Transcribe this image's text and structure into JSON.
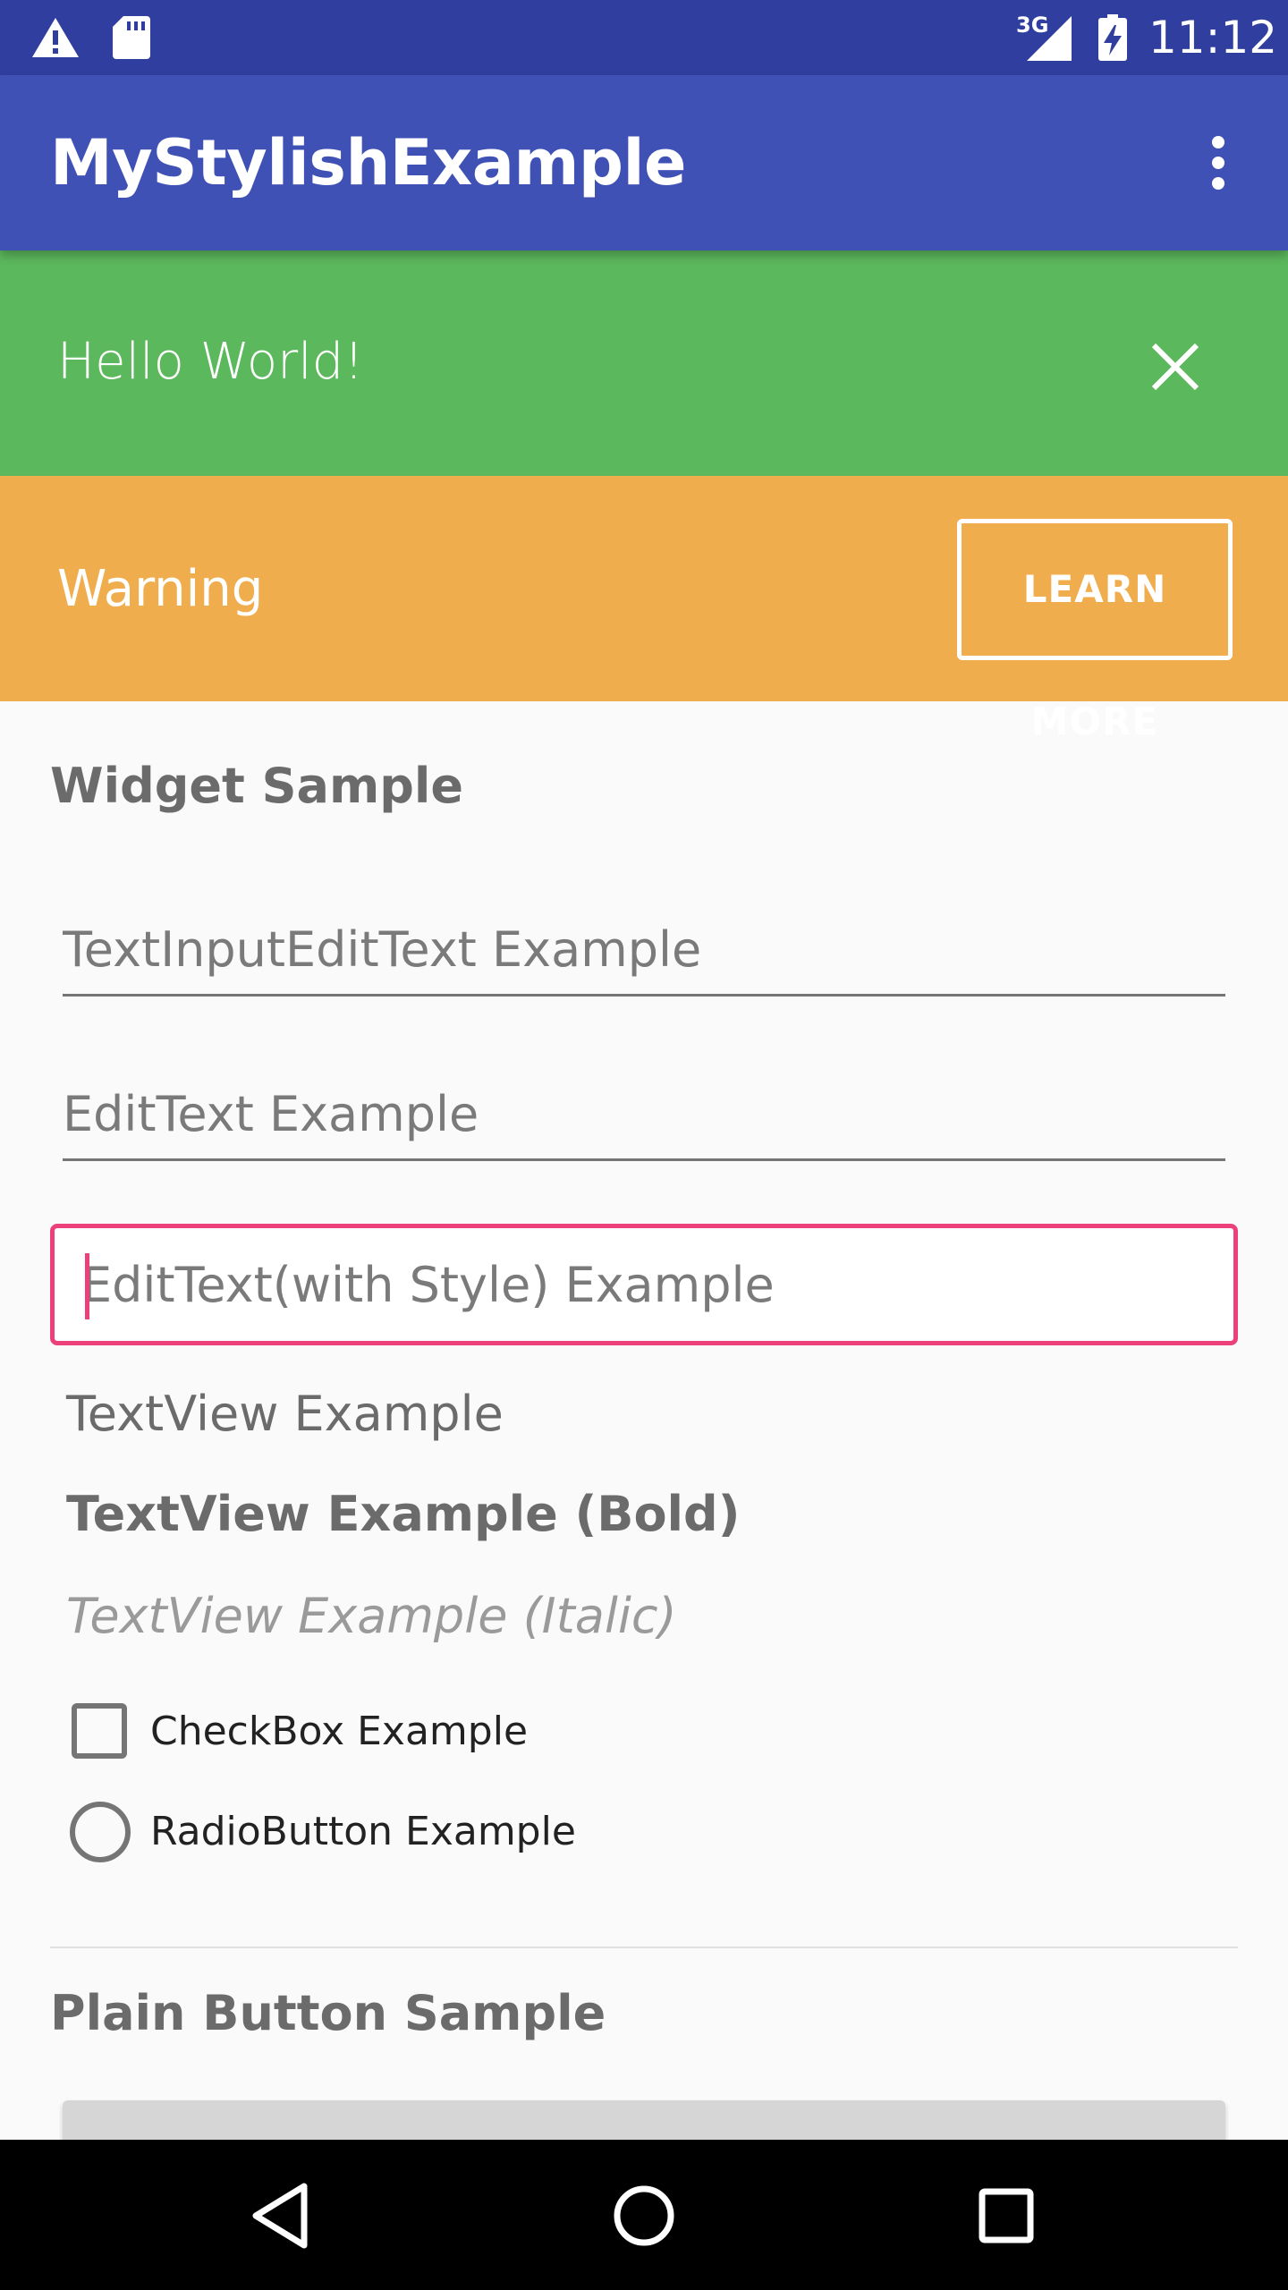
{
  "status_bar": {
    "time": "11:12",
    "network": "3G",
    "icons": [
      "warning-icon",
      "sd-card-icon",
      "signal-icon",
      "battery-charging-icon"
    ]
  },
  "app_bar": {
    "title": "MyStylishExample",
    "overflow_icon": "more-vert-icon"
  },
  "banners": {
    "success": {
      "message": "Hello World!",
      "close_icon": "close-icon",
      "color": "#5cb85c"
    },
    "warning": {
      "message": "Warning",
      "button_label": "LEARN MORE",
      "color": "#f0ad4e"
    }
  },
  "widget_sample": {
    "title": "Widget Sample",
    "text_input_edit_text": {
      "placeholder": "TextInputEditText Example",
      "value": ""
    },
    "edit_text": {
      "placeholder": "EditText Example",
      "value": ""
    },
    "edit_text_styled": {
      "placeholder": "EditText(with Style) Example",
      "value": "",
      "accent_color": "#ec407a"
    },
    "text_view": "TextView Example",
    "text_view_bold": "TextView Example (Bold)",
    "text_view_italic": "TextView Example (Italic)",
    "checkbox": {
      "label": "CheckBox Example",
      "checked": false
    },
    "radio": {
      "label": "RadioButton Example",
      "selected": false
    }
  },
  "plain_button_sample": {
    "title": "Plain Button Sample"
  },
  "colors": {
    "status_bar": "#303f9f",
    "app_bar": "#3f51b5",
    "background": "#fafafa"
  },
  "nav_bar": {
    "icons": [
      "back-icon",
      "home-icon",
      "recents-icon"
    ]
  }
}
